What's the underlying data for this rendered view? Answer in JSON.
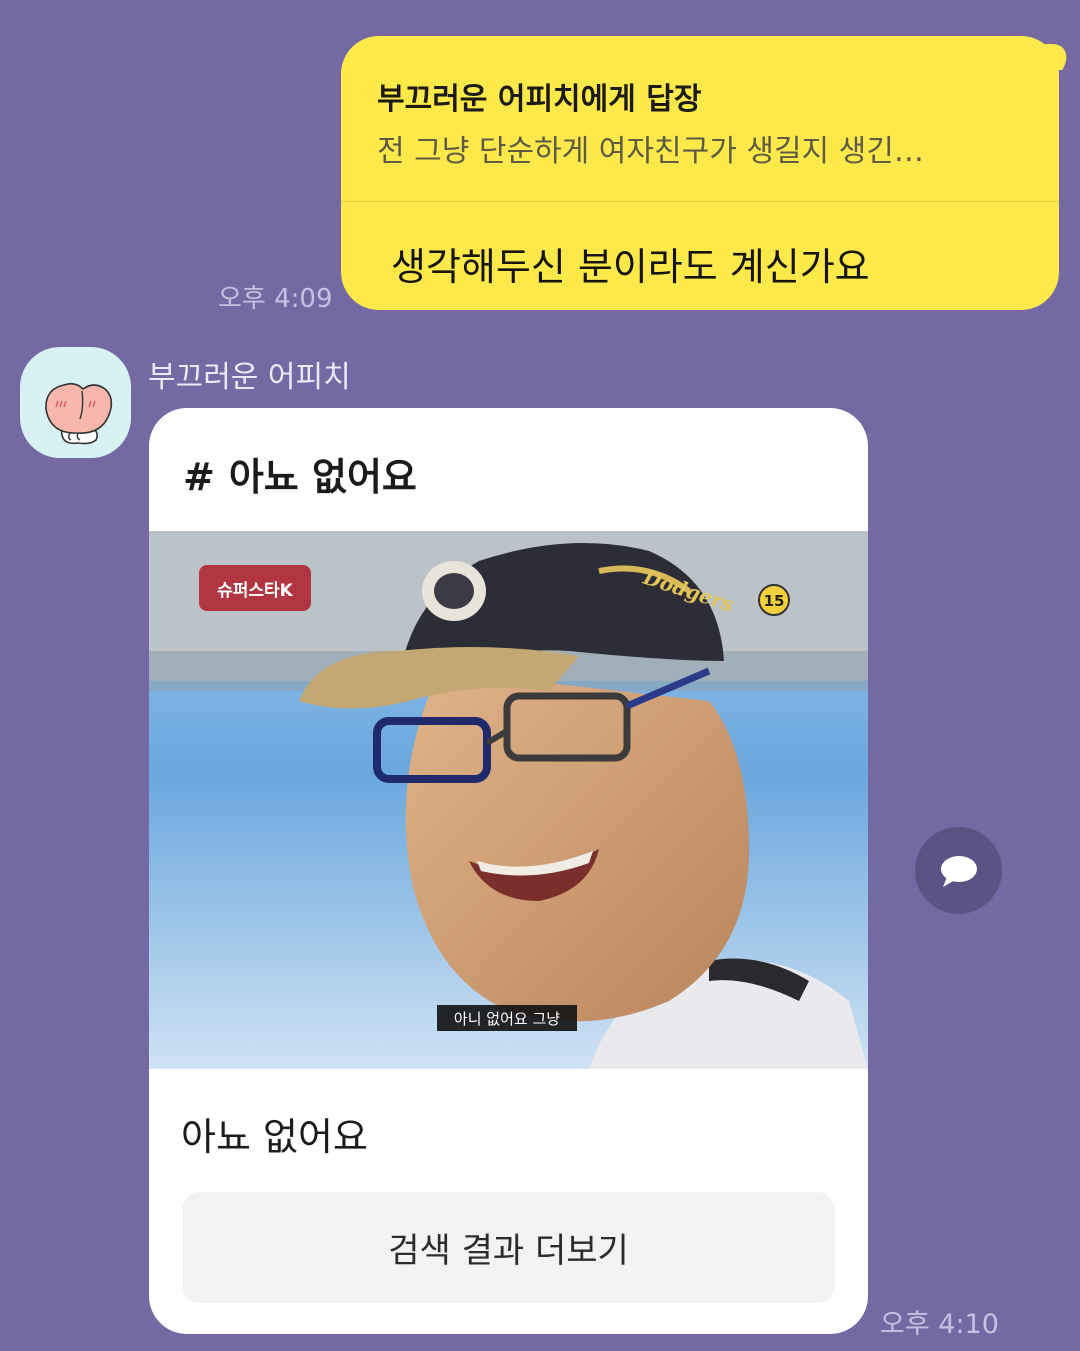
{
  "reply": {
    "quote_title": "부끄러운 어피치에게 답장",
    "quote_text": "전 그냥 단순하게 여자친구가 생길지 생긴…",
    "text": "생각해두신 분이라도 계신가요",
    "time": "오후 4:09"
  },
  "incoming": {
    "sender": "부끄러운 어피치",
    "avatar_icon": "peach-character-icon",
    "card": {
      "hash_symbol": "#",
      "heading": "아뇨 없어요",
      "image": {
        "program_logo": "슈퍼스타K",
        "rating_badge": "15",
        "cap_text": "Dodgers",
        "subtitle": "아니 없어요 그냥"
      },
      "caption": "아뇨 없어요",
      "more_button": "검색 결과 더보기"
    },
    "share_icon": "speech-bubble-icon",
    "time": "오후 4:10"
  },
  "colors": {
    "background": "#7469a3",
    "my_bubble": "#fee94a",
    "card": "#ffffff"
  }
}
